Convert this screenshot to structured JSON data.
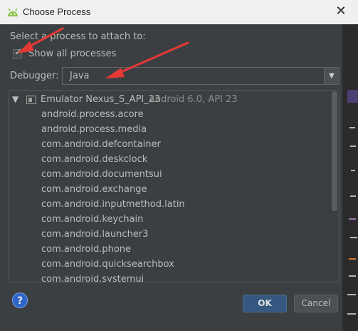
{
  "window": {
    "title": "Choose Process",
    "close_glyph": "✕"
  },
  "form": {
    "select_label": "Select a process to attach to:",
    "show_all_label": "Show all processes",
    "show_all_checked": true,
    "debugger_label": "Debugger:",
    "debugger_value": "Java"
  },
  "tree": {
    "device_name": "Emulator Nexus_S_API_23",
    "device_version": "Android 6.0, API 23",
    "processes": [
      "android.process.acore",
      "android.process.media",
      "com.android.defcontainer",
      "com.android.deskclock",
      "com.android.documentsui",
      "com.android.exchange",
      "com.android.inputmethod.latin",
      "com.android.keychain",
      "com.android.launcher3",
      "com.android.phone",
      "com.android.quicksearchbox",
      "com.android.systemui"
    ]
  },
  "buttons": {
    "help": "?",
    "ok": "OK",
    "cancel": "Cancel"
  },
  "colors": {
    "accent": "#365880",
    "annotation_arrow": "#e53935",
    "background": "#3c3f41"
  },
  "icons": [
    "android-studio-icon",
    "close-icon",
    "dropdown-arrow-icon",
    "tree-expand-icon",
    "emulator-icon",
    "help-icon"
  ]
}
